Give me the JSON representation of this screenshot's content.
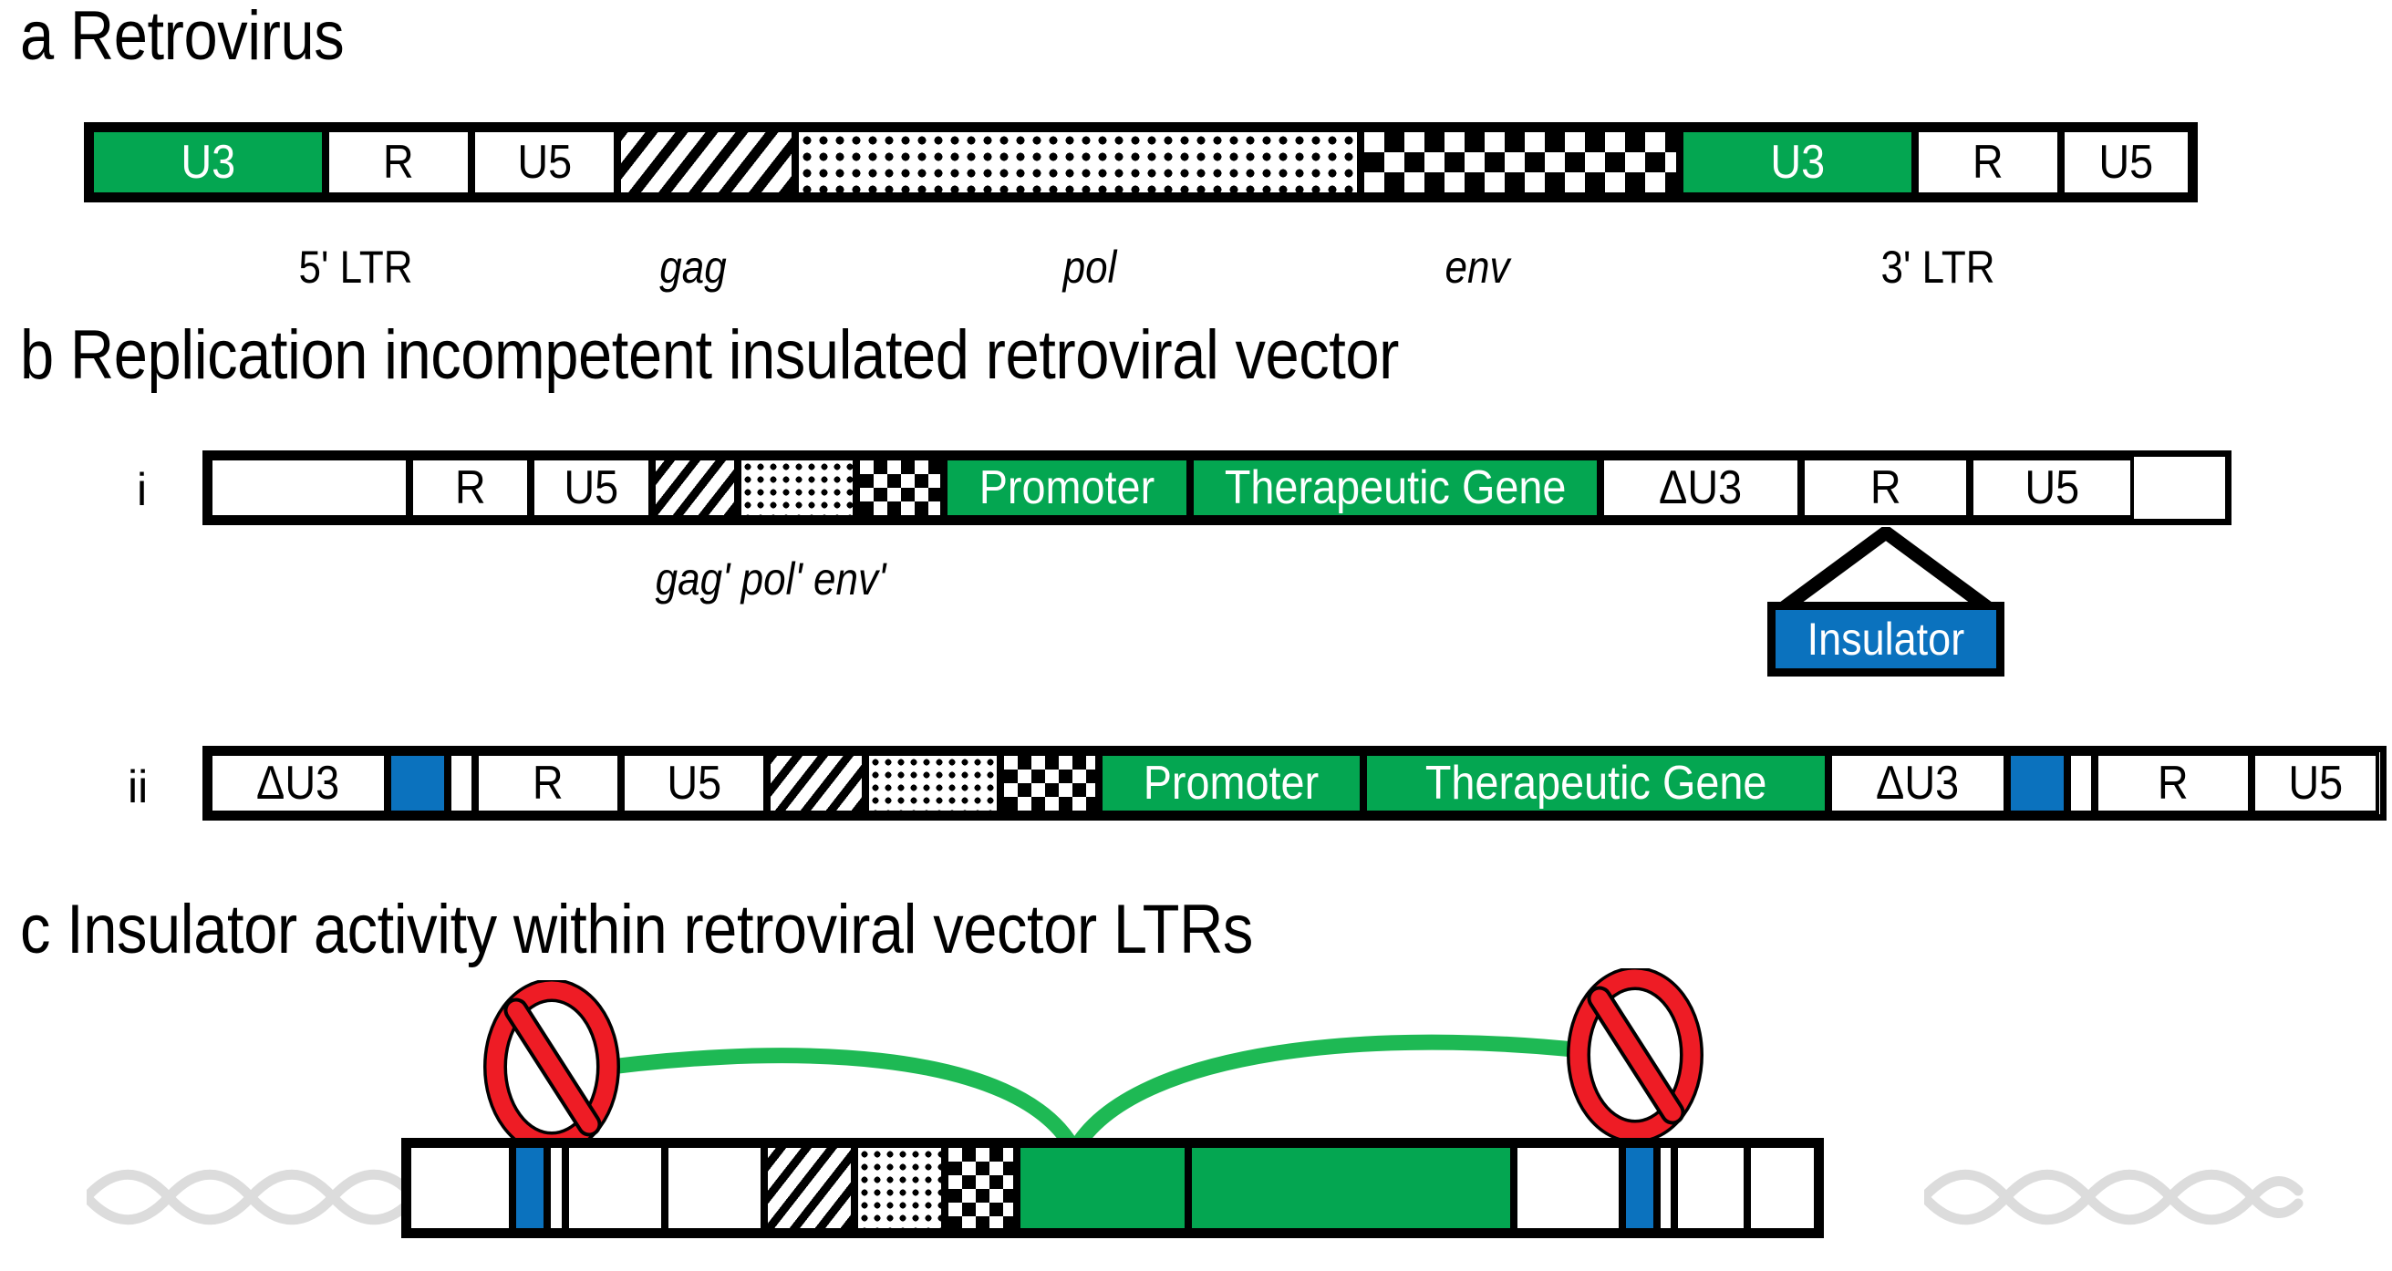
{
  "figure": {
    "panels": [
      {
        "key": "a",
        "letter": "a",
        "title": "Retrovirus",
        "construct": {
          "segments": [
            {
              "label": "U3",
              "style": "green"
            },
            {
              "label": "R",
              "style": "plain"
            },
            {
              "label": "U5",
              "style": "plain"
            },
            {
              "label": "",
              "style": "hatch"
            },
            {
              "label": "",
              "style": "dots"
            },
            {
              "label": "",
              "style": "checker"
            },
            {
              "label": "U3",
              "style": "green"
            },
            {
              "label": "R",
              "style": "plain"
            },
            {
              "label": "U5",
              "style": "plain"
            }
          ]
        },
        "annotations": [
          {
            "text": "5' LTR",
            "italic": false
          },
          {
            "text": "gag",
            "italic": true
          },
          {
            "text": "pol",
            "italic": true
          },
          {
            "text": "env",
            "italic": true
          },
          {
            "text": "3' LTR",
            "italic": false
          }
        ]
      },
      {
        "key": "b",
        "letter": "b",
        "title": "Replication incompetent insulated retroviral vector",
        "rows": [
          {
            "marker": "i",
            "segments": [
              {
                "label": "",
                "style": "plain"
              },
              {
                "label": "R",
                "style": "plain"
              },
              {
                "label": "U5",
                "style": "plain"
              },
              {
                "label": "",
                "style": "hatch"
              },
              {
                "label": "",
                "style": "dots"
              },
              {
                "label": "",
                "style": "checker"
              },
              {
                "label": "Promoter",
                "style": "green"
              },
              {
                "label": "Therapeutic Gene",
                "style": "green"
              },
              {
                "label": "ΔU3",
                "style": "plain"
              },
              {
                "label": "R",
                "style": "plain"
              },
              {
                "label": "U5",
                "style": "plain"
              }
            ],
            "annotation": "gag' pol' env'",
            "callout_label": "Insulator"
          },
          {
            "marker": "ii",
            "segments": [
              {
                "label": "ΔU3",
                "style": "plain"
              },
              {
                "label": "",
                "style": "blue"
              },
              {
                "label": "",
                "style": "plain"
              },
              {
                "label": "R",
                "style": "plain"
              },
              {
                "label": "U5",
                "style": "plain"
              },
              {
                "label": "",
                "style": "hatch"
              },
              {
                "label": "",
                "style": "dots"
              },
              {
                "label": "",
                "style": "checker"
              },
              {
                "label": "Promoter",
                "style": "green"
              },
              {
                "label": "Therapeutic Gene",
                "style": "green"
              },
              {
                "label": "ΔU3",
                "style": "plain"
              },
              {
                "label": "",
                "style": "blue"
              },
              {
                "label": "",
                "style": "plain"
              },
              {
                "label": "R",
                "style": "plain"
              },
              {
                "label": "U5",
                "style": "plain"
              }
            ]
          }
        ]
      },
      {
        "key": "c",
        "letter": "c",
        "title": "Insulator activity within retroviral vector LTRs",
        "construct": {
          "segments": [
            {
              "label": "",
              "style": "plain"
            },
            {
              "label": "",
              "style": "blue"
            },
            {
              "label": "",
              "style": "plain"
            },
            {
              "label": "",
              "style": "plain"
            },
            {
              "label": "",
              "style": "plain"
            },
            {
              "label": "",
              "style": "hatch"
            },
            {
              "label": "",
              "style": "dots"
            },
            {
              "label": "",
              "style": "checker"
            },
            {
              "label": "",
              "style": "green"
            },
            {
              "label": "",
              "style": "green"
            },
            {
              "label": "",
              "style": "plain"
            },
            {
              "label": "",
              "style": "blue"
            },
            {
              "label": "",
              "style": "plain"
            },
            {
              "label": "",
              "style": "plain"
            },
            {
              "label": "",
              "style": "plain"
            }
          ]
        },
        "blocked_signs": 2,
        "enhancer_arcs": 2
      }
    ]
  },
  "colors": {
    "green": "#04A651",
    "blue": "#0B72BE",
    "red": "#EE1C25",
    "black": "#000000",
    "white": "#FFFFFF",
    "helix_grey": "#DCDCDC"
  }
}
